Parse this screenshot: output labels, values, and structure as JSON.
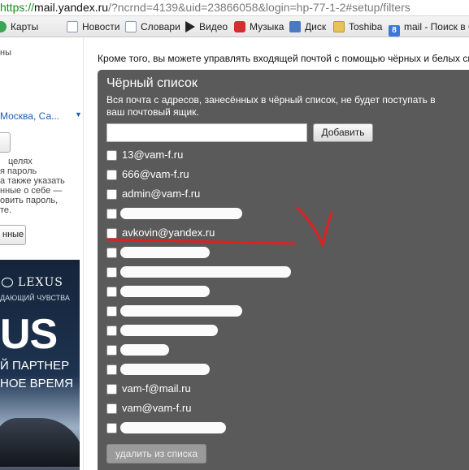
{
  "browser": {
    "url_scheme": "https://",
    "url_host": "mail.yandex.ru",
    "url_rest": "/?ncrnd=4139&uid=23866058&login=hp-77-1-2#setup/filters"
  },
  "bookmarks": [
    {
      "label": "Карты",
      "icon": "maps-icon"
    },
    {
      "label": "Новости",
      "icon": "news-icon"
    },
    {
      "label": "Словари",
      "icon": "dictionary-icon"
    },
    {
      "label": "Видео",
      "icon": "video-icon"
    },
    {
      "label": "Музыка",
      "icon": "music-icon"
    },
    {
      "label": "Диск",
      "icon": "disk-icon"
    },
    {
      "label": "Toshiba",
      "icon": "folder-icon"
    },
    {
      "label": "mail - Поиск в G",
      "icon": "google-icon"
    }
  ],
  "sidebar": {
    "frag_top": "ны",
    "city": "Москва, Са...",
    "frag_lines": [
      "целях",
      "я пароль",
      "а также указать",
      "нные о себе —",
      "овить пароль,",
      "те."
    ],
    "frag_button": "нные"
  },
  "ad": {
    "brand": "LEXUS",
    "tagline": "ДАЮЩИЙ ЧУВСТВА",
    "big": "US",
    "line1": "Й ПАРТНЕР",
    "line2": "НОЕ ВРЕМЯ"
  },
  "main": {
    "intro": "Кроме того, вы можете управлять входящей почтой с помощью чёрных и белых спис"
  },
  "blacklist": {
    "title": "Чёрный список",
    "description": "Вся почта с адресов, занесённых в чёрный список, не будет поступать в ваш почтовый ящик.",
    "input_value": "",
    "add_label": "Добавить",
    "delete_label": "удалить из списка",
    "entries": [
      {
        "text": "13@vam-f.ru",
        "redacted": false
      },
      {
        "text": "666@vam-f.ru",
        "redacted": false
      },
      {
        "text": "admin@vam-f.ru",
        "redacted": false
      },
      {
        "text": "",
        "redacted": true
      },
      {
        "text": "avkovin@yandex.ru",
        "redacted": false
      },
      {
        "text": "",
        "redacted": true
      },
      {
        "text": "",
        "redacted": true
      },
      {
        "text": "",
        "redacted": true
      },
      {
        "text": "",
        "redacted": true
      },
      {
        "text": "",
        "redacted": true
      },
      {
        "text": "",
        "redacted": true
      },
      {
        "text": "",
        "redacted": true
      },
      {
        "text": "vam-f@mail.ru",
        "redacted": false
      },
      {
        "text": "vam@vam-f.ru",
        "redacted": false
      },
      {
        "text": "",
        "redacted": true
      }
    ]
  },
  "colors": {
    "panel": "#5a5a5a",
    "annotation": "#e02020",
    "url_scheme": "#1b8a1b"
  }
}
